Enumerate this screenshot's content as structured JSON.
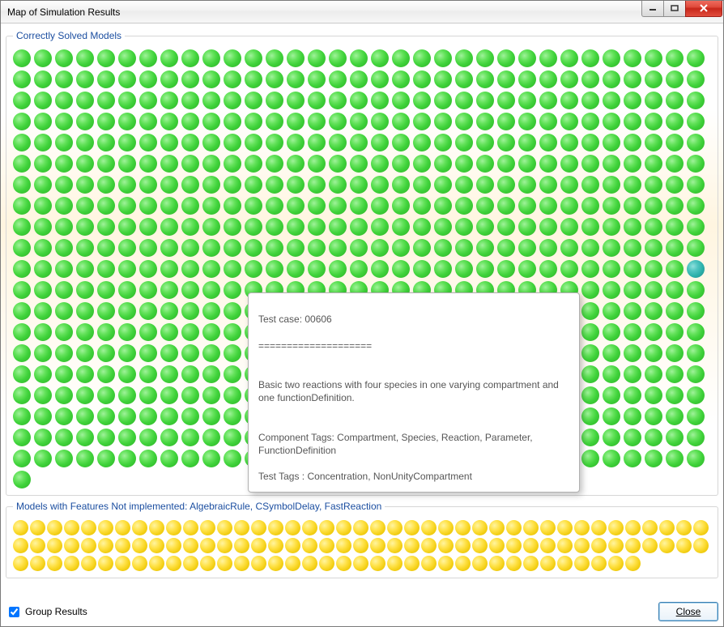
{
  "window": {
    "title": "Map of Simulation Results"
  },
  "groups": {
    "solved": {
      "legend": "Correctly Solved Models",
      "dot_count": 661,
      "cols": 32,
      "highlight_index": 362
    },
    "not_impl": {
      "legend": "Models with Features Not implemented: AlgebraicRule, CSymbolDelay, FastReaction",
      "dot_count": 119
    }
  },
  "tooltip": {
    "line1": "Test case: 00606",
    "line2": "====================",
    "desc": "Basic two reactions with four species in one varying compartment and one functionDefinition.",
    "comp": "Component Tags: Compartment, Species, Reaction, Parameter, FunctionDefinition",
    "test": "Test Tags         : Concentration, NonUnityCompartment"
  },
  "footer": {
    "checkbox_label": "Group Results",
    "checkbox_checked": true,
    "close_label": "Close"
  }
}
